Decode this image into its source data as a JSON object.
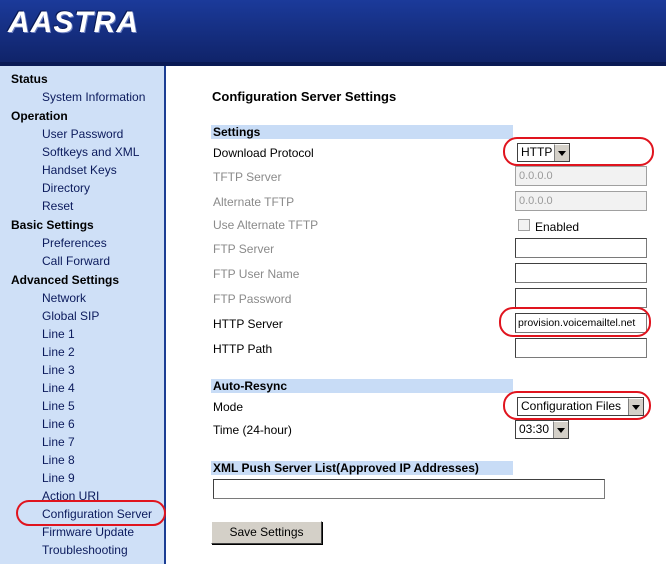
{
  "header": {
    "logo_text": "AASTRA"
  },
  "sidebar": {
    "sections": [
      {
        "title": "Status",
        "items": [
          "System Information"
        ]
      },
      {
        "title": "Operation",
        "items": [
          "User Password",
          "Softkeys and XML",
          "Handset Keys",
          "Directory",
          "Reset"
        ]
      },
      {
        "title": "Basic Settings",
        "items": [
          "Preferences",
          "Call Forward"
        ]
      },
      {
        "title": "Advanced Settings",
        "items": [
          "Network",
          "Global SIP",
          "Line 1",
          "Line 2",
          "Line 3",
          "Line 4",
          "Line 5",
          "Line 6",
          "Line 7",
          "Line 8",
          "Line 9",
          "Action URI",
          "Configuration Server",
          "Firmware Update",
          "Troubleshooting"
        ]
      }
    ],
    "active_item": "Configuration Server"
  },
  "page": {
    "title": "Configuration Server Settings",
    "settings_header": "Settings",
    "download_protocol_label": "Download Protocol",
    "download_protocol_value": "HTTP",
    "tftp_server_label": "TFTP Server",
    "tftp_server_value": "0.0.0.0",
    "alt_tftp_label": "Alternate TFTP",
    "alt_tftp_value": "0.0.0.0",
    "use_alt_tftp_label": "Use Alternate TFTP",
    "enabled_label": "Enabled",
    "ftp_server_label": "FTP Server",
    "ftp_user_label": "FTP User Name",
    "ftp_password_label": "FTP Password",
    "http_server_label": "HTTP Server",
    "http_server_value": "provision.voicemailtel.net",
    "http_path_label": "HTTP Path",
    "autoresync_header": "Auto-Resync",
    "mode_label": "Mode",
    "mode_value": "Configuration Files",
    "time_label": "Time (24-hour)",
    "time_value": "03:30",
    "xml_header": "XML Push Server List(Approved IP Addresses)",
    "save_button": "Save Settings"
  },
  "colors": {
    "header_bg": "#142a7a",
    "sidebar_bg": "#cfe0f7",
    "section_bar": "#c8dcf6",
    "highlight_ellipse": "#e0141e"
  }
}
